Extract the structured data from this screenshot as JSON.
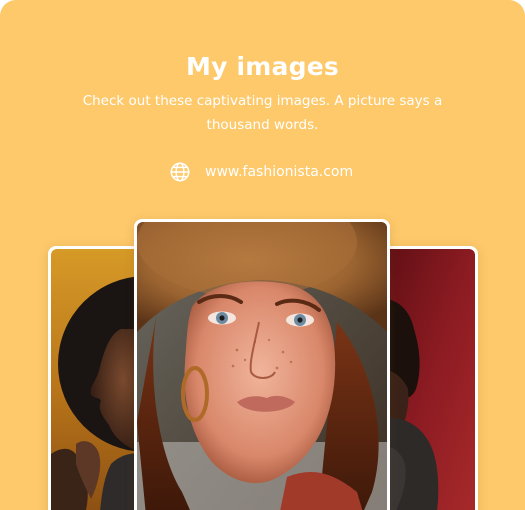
{
  "header": {
    "title": "My images",
    "subtitle": "Check out these captivating images. A picture says a thousand words."
  },
  "website": {
    "icon": "globe-icon",
    "url": "www.fashionista.com"
  },
  "gallery": {
    "images": [
      {
        "subject": "man in profile against dark disc on amber background"
      },
      {
        "subject": "freckled woman wearing straw hat"
      },
      {
        "subject": "person in turtleneck against red background"
      }
    ]
  },
  "colors": {
    "background": "#fdc96b",
    "text": "#ffffff",
    "photo_frame": "#ffffff"
  }
}
